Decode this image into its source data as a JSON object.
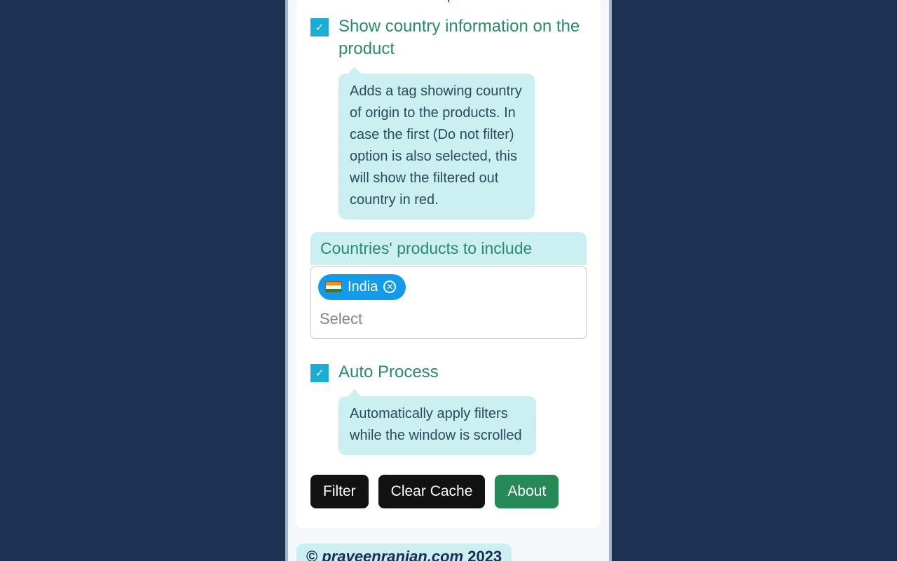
{
  "options": {
    "show_country_info": {
      "label": "Show country information on the product",
      "checked": true,
      "desc": "Adds a tag showing country of origin to the products. In case the first (Do not filter) option is also selected, this will show the filtered out country in red."
    },
    "auto_process": {
      "label": "Auto Process",
      "checked": true,
      "desc": "Automatically apply filters while the window is scrolled"
    }
  },
  "include_section": {
    "header": "Countries' products to include",
    "chips": [
      {
        "name": "India"
      }
    ],
    "placeholder": "Select"
  },
  "buttons": {
    "filter": "Filter",
    "clear_cache": "Clear Cache",
    "about": "About"
  },
  "footer": {
    "copyright_symbol": "©",
    "link_text": "praveenranjan.com",
    "year": "2023"
  }
}
